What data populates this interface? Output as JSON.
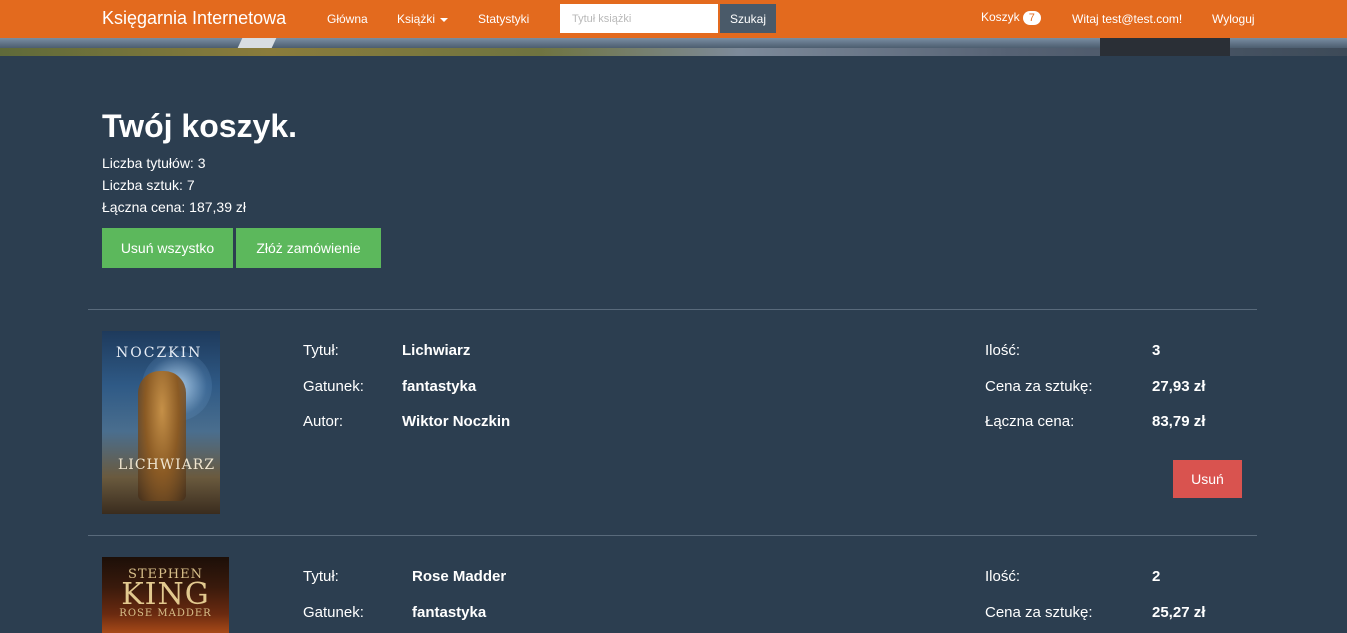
{
  "navbar": {
    "brand": "Księgarnia Internetowa",
    "links": {
      "home": "Główna",
      "books": "Książki",
      "stats": "Statystyki"
    },
    "search": {
      "placeholder": "Tytuł książki",
      "button": "Szukaj"
    },
    "cart": {
      "label": "Koszyk",
      "count": "7"
    },
    "greeting": "Witaj test@test.com!",
    "logout": "Wyloguj"
  },
  "cart": {
    "title": "Twój koszyk.",
    "titles_count": "Liczba tytułów: 3",
    "items_count": "Liczba sztuk: 7",
    "total": "Łączna cena: 187,39 zł",
    "remove_all": "Usuń wszystko",
    "order": "Złóż zamówienie"
  },
  "labels": {
    "title": "Tytuł:",
    "genre": "Gatunek:",
    "author": "Autor:",
    "quantity": "Ilość:",
    "unit_price": "Cena za sztukę:",
    "total_price": "Łączna cena:",
    "remove": "Usuń"
  },
  "items": [
    {
      "title": "Lichwiarz",
      "genre": "fantastyka",
      "author": "Wiktor Noczkin",
      "quantity": "3",
      "unit_price": "27,93 zł",
      "total_price": "83,79 zł",
      "cover_text": {
        "name": "NOCZKIN",
        "title": "LICHWIARZ"
      }
    },
    {
      "title": "Rose Madder",
      "genre": "fantastyka",
      "quantity": "2",
      "unit_price": "25,27 zł",
      "cover_text": {
        "author": "STEPHEN",
        "surname": "KING",
        "title": "ROSE MADDER"
      }
    }
  ],
  "colors": {
    "navbar": "#e36a1e",
    "background": "#2c3e50",
    "success": "#5cb85c",
    "danger": "#d9534f"
  }
}
